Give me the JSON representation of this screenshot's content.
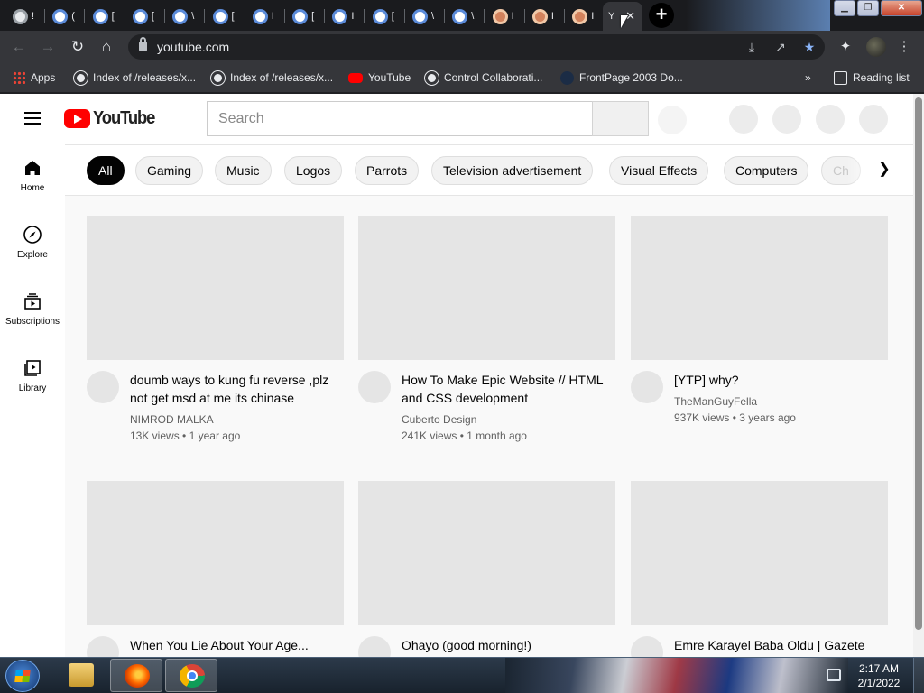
{
  "browser": {
    "tabs": [
      {
        "title": "!",
        "icon": "world-icon"
      },
      {
        "title": "(",
        "icon": "google-icon"
      },
      {
        "title": "[",
        "icon": "google-icon"
      },
      {
        "title": "[",
        "icon": "google-icon"
      },
      {
        "title": "\\",
        "icon": "google-icon"
      },
      {
        "title": "[",
        "icon": "google-icon"
      },
      {
        "title": "I",
        "icon": "google-icon"
      },
      {
        "title": "[",
        "icon": "google-icon"
      },
      {
        "title": "I",
        "icon": "google-icon"
      },
      {
        "title": "[",
        "icon": "google-icon"
      },
      {
        "title": "\\",
        "icon": "google-icon"
      },
      {
        "title": "\\",
        "icon": "google-icon"
      },
      {
        "title": "I",
        "icon": "emblem-icon"
      },
      {
        "title": "I",
        "icon": "emblem-icon"
      },
      {
        "title": "I",
        "icon": "emblem-icon"
      }
    ],
    "active_tab": {
      "title": "Y",
      "close": "✕"
    },
    "new_tab": "+",
    "window_buttons": {
      "minimize": "▁",
      "maximize": "❐",
      "close": "✕"
    },
    "url": "youtube.com",
    "bookmarks": [
      {
        "label": "Apps",
        "icon": "apps-grid-icon"
      },
      {
        "label": "Index of /releases/x...",
        "icon": "world-icon"
      },
      {
        "label": "Index of /releases/x...",
        "icon": "world-icon"
      },
      {
        "label": "YouTube",
        "icon": "youtube-icon"
      },
      {
        "label": "Control Collaborati...",
        "icon": "world-icon"
      },
      {
        "label": "FrontPage 2003 Do...",
        "icon": "frontpage-icon"
      }
    ],
    "bookmarks_overflow": "»",
    "reading_list": "Reading list"
  },
  "youtube": {
    "logo_text": "YouTube",
    "search_placeholder": "Search",
    "guide": [
      {
        "label": "Home",
        "icon": "home-icon"
      },
      {
        "label": "Explore",
        "icon": "compass-icon"
      },
      {
        "label": "Subscriptions",
        "icon": "subscriptions-icon"
      },
      {
        "label": "Library",
        "icon": "library-icon"
      }
    ],
    "chips": [
      "All",
      "Gaming",
      "Music",
      "Logos",
      "Parrots",
      "Television advertisement",
      "Visual Effects",
      "Computers",
      "Ch"
    ],
    "videos": [
      {
        "title": "doumb ways to kung fu reverse ,plz not get msd at me its chinase",
        "channel": "NIMROD MALKA",
        "views": "13K views",
        "age": "1 year ago"
      },
      {
        "title": "How To Make Epic Website // HTML and CSS development",
        "channel": "Cuberto Design",
        "views": "241K views",
        "age": "1 month ago"
      },
      {
        "title": "[YTP] why?",
        "channel": "TheManGuyFella",
        "views": "937K views",
        "age": "3 years ago"
      },
      {
        "title": "When You Lie About Your Age...",
        "channel": "",
        "views": "",
        "age": ""
      },
      {
        "title": "Ohayo (good morning!)",
        "channel": "",
        "views": "",
        "age": ""
      },
      {
        "title": "Emre Karayel Baba Oldu | Gazete",
        "channel": "",
        "views": "",
        "age": ""
      }
    ],
    "meta_separator": "•"
  },
  "taskbar": {
    "apps": [
      "windows-explorer-icon",
      "firefox-icon",
      "chrome-icon"
    ],
    "time": "2:17 AM",
    "date": "2/1/2022"
  }
}
